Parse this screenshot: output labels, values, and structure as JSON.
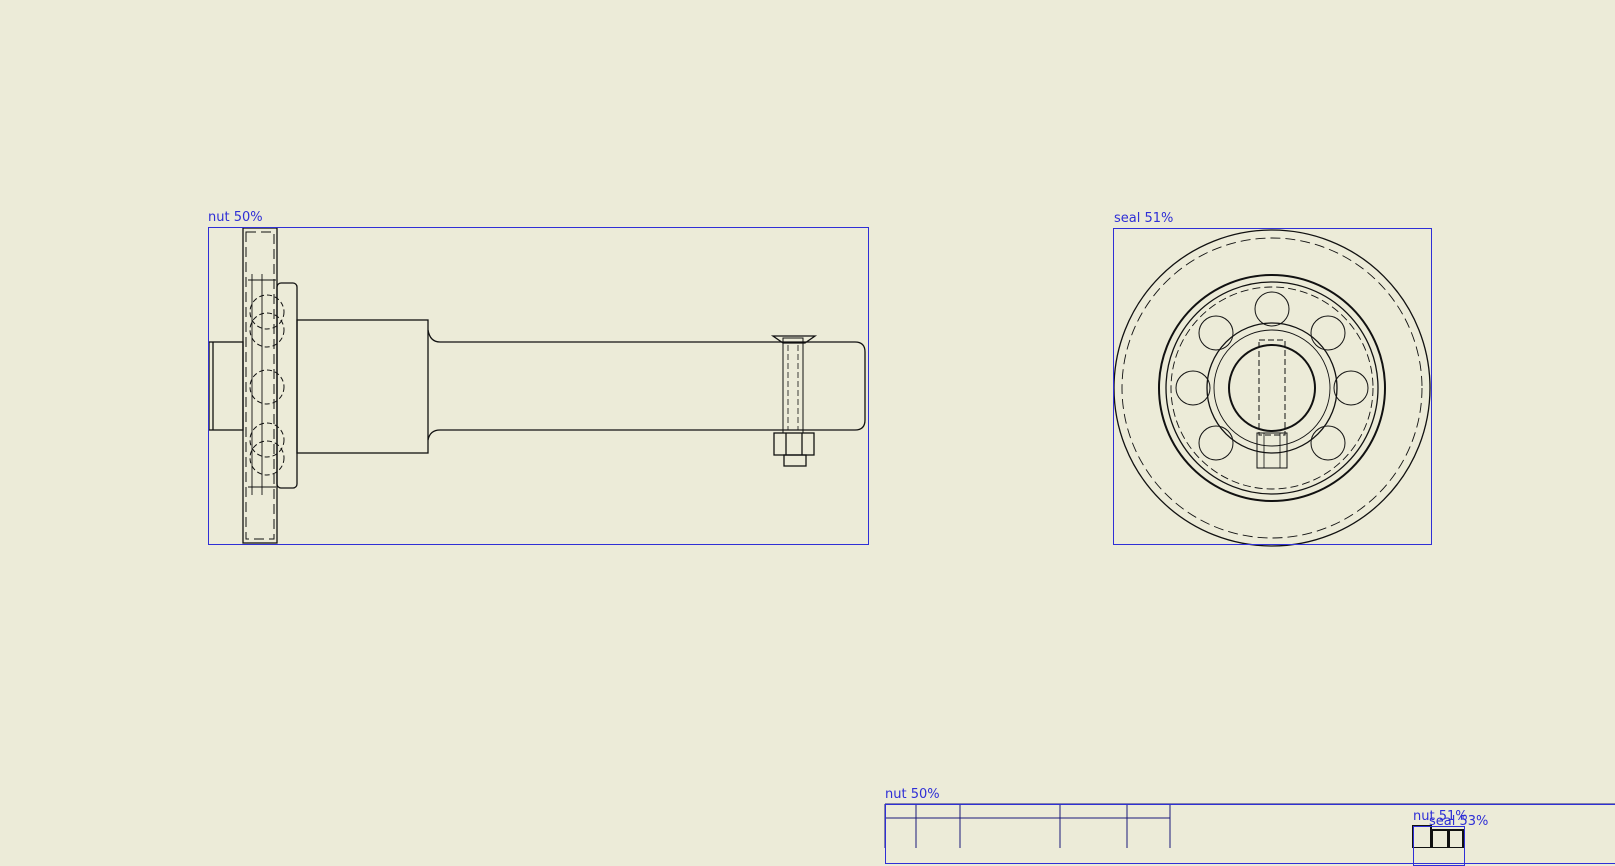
{
  "detections": [
    {
      "id": "det1",
      "label": "nut 50%"
    },
    {
      "id": "det2",
      "label": "seal 51%"
    },
    {
      "id": "det3",
      "label": "nut 50%"
    },
    {
      "id": "det4",
      "label": "nut 51%"
    },
    {
      "id": "det5",
      "label": "seal 53%"
    }
  ],
  "colors": {
    "background": "#ecebd8",
    "detection_box": "#2f2fd6",
    "drawing_lines": "#111111"
  }
}
